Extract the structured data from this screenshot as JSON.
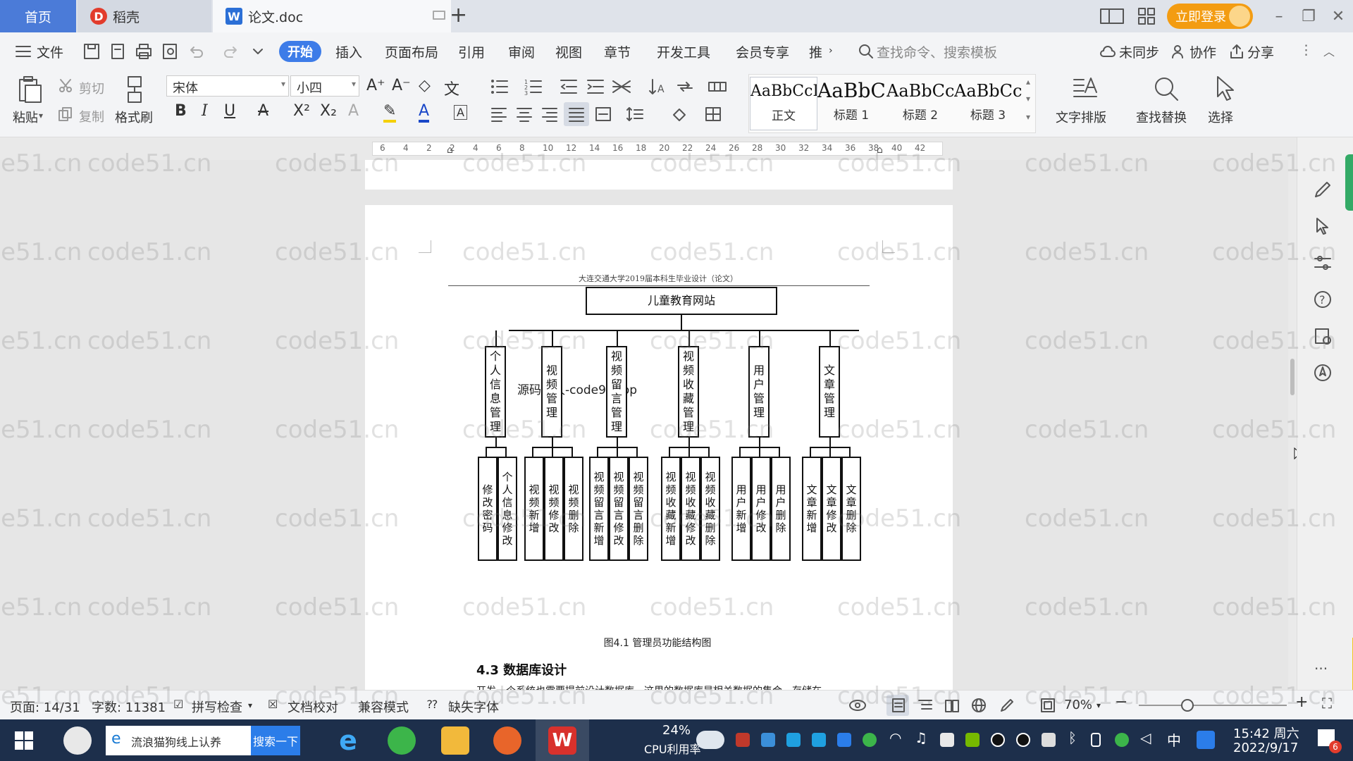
{
  "tabs": {
    "home": "首页",
    "daoke": "稻壳",
    "doc": "论文.doc",
    "add": "+"
  },
  "titlebar": {
    "login": "立即登录"
  },
  "menu": {
    "file": "文件",
    "items": [
      "开始",
      "插入",
      "页面布局",
      "引用",
      "审阅",
      "视图",
      "章节",
      "开发工具",
      "会员专享",
      "推"
    ],
    "search_cmd": "查找命令、搜索模板",
    "unsynced": "未同步",
    "collab": "协作",
    "share": "分享"
  },
  "ribbon": {
    "paste": "粘贴",
    "cut": "剪切",
    "copy": "复制",
    "format_painter": "格式刷",
    "font_name": "宋体",
    "font_size": "小四",
    "styles": [
      {
        "preview": "AaBbCcI",
        "name": "正文"
      },
      {
        "preview": "AaBbC",
        "name": "标题 1"
      },
      {
        "preview": "AaBbCc",
        "name": "标题 2"
      },
      {
        "preview": "AaBbCc",
        "name": "标题 3"
      }
    ],
    "text_layout": "文字排版",
    "find_replace": "查找替换",
    "select": "选择"
  },
  "ruler": {
    "ticks": [
      "6",
      "4",
      "2",
      "2",
      "4",
      "6",
      "8",
      "10",
      "12",
      "14",
      "16",
      "18",
      "20",
      "22",
      "24",
      "26",
      "28",
      "30",
      "32",
      "34",
      "36",
      "38",
      "40",
      "42"
    ]
  },
  "document": {
    "header": "大连交通大学2019届本科生毕业设计（论文）",
    "root": "儿童教育网站",
    "modules": [
      {
        "name": "个人信息管理",
        "children": [
          "修改密码",
          "个人信息修改"
        ]
      },
      {
        "name": "视频管理",
        "children": [
          "视频新增",
          "视频修改",
          "视频删除"
        ]
      },
      {
        "name": "视频留言管理",
        "children": [
          "视频留言新增",
          "视频留言修改",
          "视频留言删除"
        ]
      },
      {
        "name": "视频收藏管理",
        "children": [
          "视频收藏新增",
          "视频收藏修改",
          "视频收藏删除"
        ]
      },
      {
        "name": "用户管理",
        "children": [
          "用户新增",
          "用户修改",
          "用户删除"
        ]
      },
      {
        "name": "文章管理",
        "children": [
          "文章新增",
          "文章修改",
          "文章删除"
        ]
      }
    ],
    "overlay_text": "源码久久-code99.top",
    "caption": "图4.1 管理员功能结构图",
    "section_heading": "4.3 数据库设计",
    "partial_line": "开发一个系统也需要提前设计数据库，这里的数据库是相关数据的集合，存储在"
  },
  "status": {
    "page": "页面: 14/31",
    "words": "字数: 11381",
    "spell": "拼写检查",
    "proof": "文档校对",
    "compat": "兼容模式",
    "missing_font": "缺失字体",
    "zoom": "70%"
  },
  "taskbar": {
    "search_text": "流浪猫狗线上认养",
    "search_btn": "搜索一下",
    "cpu_pct": "24%",
    "cpu_label": "CPU利用率",
    "ime": "中",
    "time": "15:42 周六",
    "date": "2022/9/17",
    "notif_count": "6"
  },
  "watermark": "code51.cn",
  "colors": {
    "accent": "#3d7ce8",
    "home_tab": "#4b7bd8",
    "login": "#f39c12",
    "taskbar": "#1d2f4b"
  }
}
